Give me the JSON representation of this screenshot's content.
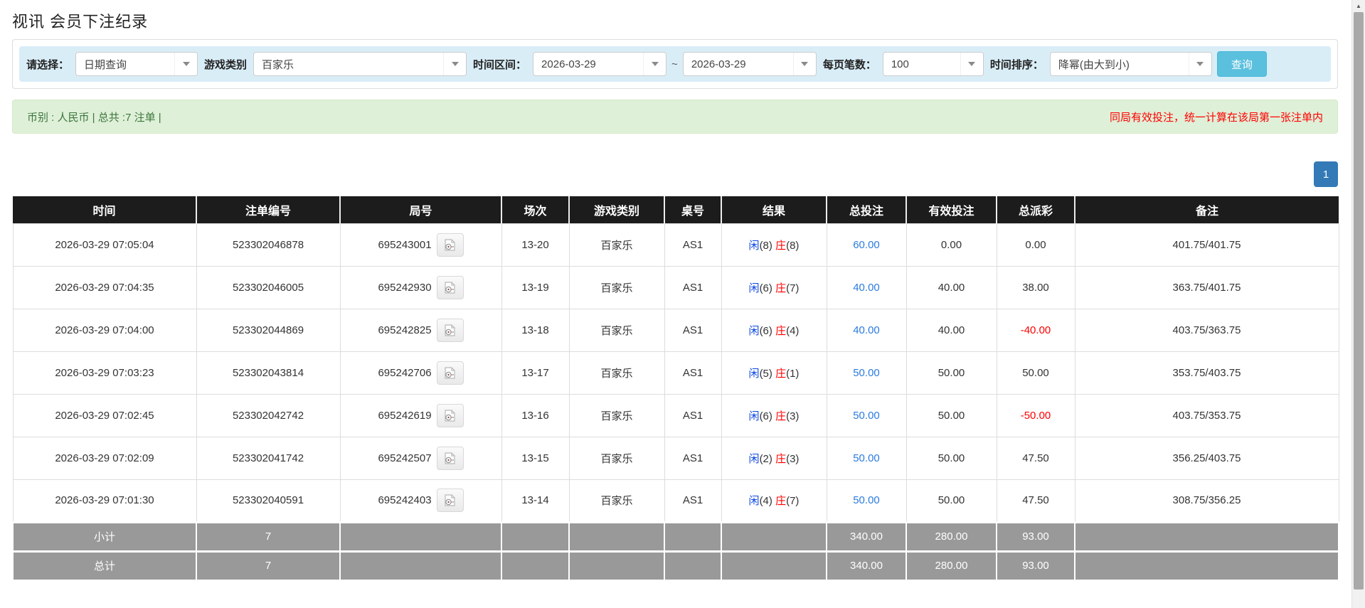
{
  "page": {
    "title": "视讯 会员下注纪录"
  },
  "filters": {
    "select_label": "请选择：",
    "select_value": "日期查询",
    "game_type_label": "游戏类别",
    "game_type_value": "百家乐",
    "time_range_label": "时间区间：",
    "date_from": "2026-03-29",
    "tilde": "~",
    "date_to": "2026-03-29",
    "page_size_label": "每页笔数：",
    "page_size_value": "100",
    "sort_label": "时间排序：",
    "sort_value": "降幂(由大到小)",
    "search_button": "查询"
  },
  "notice": {
    "left_text": "币别 : 人民币 | 总共 :7 注单 |",
    "right_text": "同局有效投注，统一计算在该局第一张注单内"
  },
  "pagination": {
    "current_page": "1"
  },
  "icons": {
    "dropdown_arrow": "caret-down",
    "round_video": "video-record-icon",
    "scroll_up": "▲",
    "scroll_down": "▼"
  },
  "colors": {
    "search_button": "#5bc0de",
    "pagination_active": "#337ab7",
    "notice_bg": "#dff0d8",
    "notice_text": "#3c763d",
    "warning_text": "#ff0000",
    "header_bg": "#1c1c1c",
    "summary_bg": "#999999",
    "total_bet_link": "#2b7bde",
    "player_blue": "#0a46e4",
    "banker_red": "#ff0000",
    "negative_red": "#ff0000"
  },
  "table": {
    "headers": [
      "时间",
      "注单编号",
      "局号",
      "场次",
      "游戏类别",
      "桌号",
      "结果",
      "总投注",
      "有效投注",
      "总派彩",
      "备注"
    ],
    "rows": [
      {
        "time": "2026-03-29 07:05:04",
        "bet_id": "523302046878",
        "round_id": "695243001",
        "session": "13-20",
        "game": "百家乐",
        "table_no": "AS1",
        "result": {
          "player_label": "闲",
          "player_score": "(8)",
          "banker_label": "庄",
          "banker_score": "(8)"
        },
        "total_bet": "60.00",
        "valid_bet": "0.00",
        "payout": "0.00",
        "remark": "401.75/401.75"
      },
      {
        "time": "2026-03-29 07:04:35",
        "bet_id": "523302046005",
        "round_id": "695242930",
        "session": "13-19",
        "game": "百家乐",
        "table_no": "AS1",
        "result": {
          "player_label": "闲",
          "player_score": "(6)",
          "banker_label": "庄",
          "banker_score": "(7)"
        },
        "total_bet": "40.00",
        "valid_bet": "40.00",
        "payout": "38.00",
        "remark": "363.75/401.75"
      },
      {
        "time": "2026-03-29 07:04:00",
        "bet_id": "523302044869",
        "round_id": "695242825",
        "session": "13-18",
        "game": "百家乐",
        "table_no": "AS1",
        "result": {
          "player_label": "闲",
          "player_score": "(6)",
          "banker_label": "庄",
          "banker_score": "(4)"
        },
        "total_bet": "40.00",
        "valid_bet": "40.00",
        "payout": "-40.00",
        "remark": "403.75/363.75"
      },
      {
        "time": "2026-03-29 07:03:23",
        "bet_id": "523302043814",
        "round_id": "695242706",
        "session": "13-17",
        "game": "百家乐",
        "table_no": "AS1",
        "result": {
          "player_label": "闲",
          "player_score": "(5)",
          "banker_label": "庄",
          "banker_score": "(1)"
        },
        "total_bet": "50.00",
        "valid_bet": "50.00",
        "payout": "50.00",
        "remark": "353.75/403.75"
      },
      {
        "time": "2026-03-29 07:02:45",
        "bet_id": "523302042742",
        "round_id": "695242619",
        "session": "13-16",
        "game": "百家乐",
        "table_no": "AS1",
        "result": {
          "player_label": "闲",
          "player_score": "(6)",
          "banker_label": "庄",
          "banker_score": "(3)"
        },
        "total_bet": "50.00",
        "valid_bet": "50.00",
        "payout": "-50.00",
        "remark": "403.75/353.75"
      },
      {
        "time": "2026-03-29 07:02:09",
        "bet_id": "523302041742",
        "round_id": "695242507",
        "session": "13-15",
        "game": "百家乐",
        "table_no": "AS1",
        "result": {
          "player_label": "闲",
          "player_score": "(2)",
          "banker_label": "庄",
          "banker_score": "(3)"
        },
        "total_bet": "50.00",
        "valid_bet": "50.00",
        "payout": "47.50",
        "remark": "356.25/403.75"
      },
      {
        "time": "2026-03-29 07:01:30",
        "bet_id": "523302040591",
        "round_id": "695242403",
        "session": "13-14",
        "game": "百家乐",
        "table_no": "AS1",
        "result": {
          "player_label": "闲",
          "player_score": "(4)",
          "banker_label": "庄",
          "banker_score": "(7)"
        },
        "total_bet": "50.00",
        "valid_bet": "50.00",
        "payout": "47.50",
        "remark": "308.75/356.25"
      }
    ],
    "subtotal": {
      "label": "小计",
      "count": "7",
      "total_bet": "340.00",
      "valid_bet": "280.00",
      "payout": "93.00"
    },
    "total": {
      "label": "总计",
      "count": "7",
      "total_bet": "340.00",
      "valid_bet": "280.00",
      "payout": "93.00"
    }
  }
}
